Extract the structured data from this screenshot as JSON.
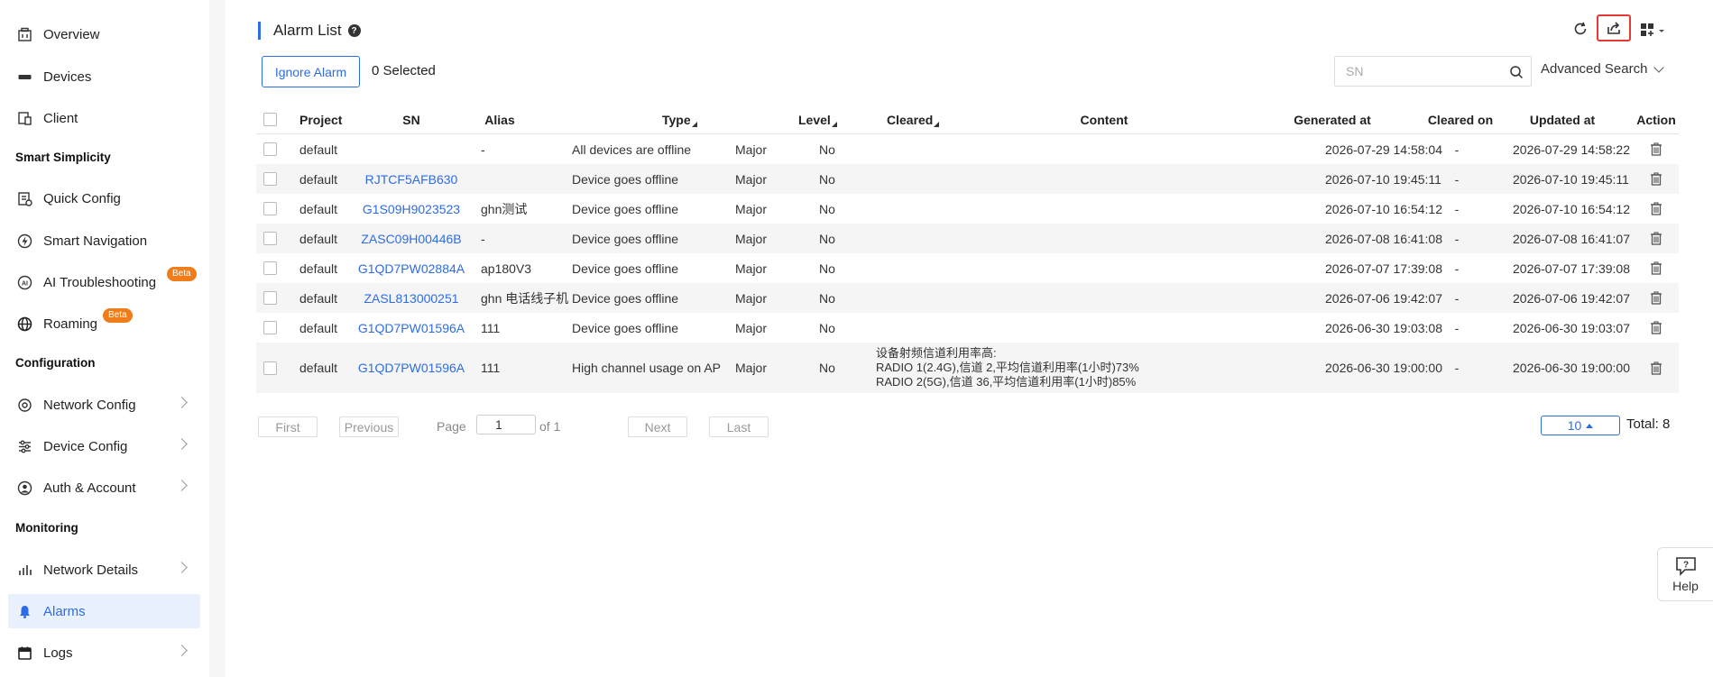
{
  "sidebar": {
    "items": [
      {
        "label": "Overview",
        "icon": "building-icon"
      },
      {
        "label": "Devices",
        "icon": "device-icon"
      },
      {
        "label": "Client",
        "icon": "client-icon"
      },
      {
        "label": "Quick Config",
        "icon": "quick-config-icon"
      },
      {
        "label": "Smart Navigation",
        "icon": "navigation-icon"
      },
      {
        "label": "AI Troubleshooting",
        "icon": "ai-icon",
        "badge": "Beta"
      },
      {
        "label": "Roaming",
        "icon": "globe-icon",
        "badge": "Beta"
      },
      {
        "label": "Network Config",
        "icon": "settings-icon"
      },
      {
        "label": "Device Config",
        "icon": "sliders-icon"
      },
      {
        "label": "Auth & Account",
        "icon": "user-icon"
      },
      {
        "label": "Network Details",
        "icon": "chart-icon"
      },
      {
        "label": "Alarms",
        "icon": "bell-icon"
      },
      {
        "label": "Logs",
        "icon": "calendar-icon"
      }
    ],
    "sections": [
      "Smart Simplicity",
      "Configuration",
      "Monitoring"
    ]
  },
  "header": {
    "title": "Alarm List",
    "help_glyph": "?"
  },
  "toolbar": {
    "ignore_label": "Ignore Alarm",
    "selected_text": "0 Selected",
    "search_placeholder": "SN",
    "advanced_search": "Advanced Search"
  },
  "table": {
    "columns": [
      "Project",
      "SN",
      "Alias",
      "Type",
      "Level",
      "Cleared",
      "Content",
      "Generated at",
      "Cleared on",
      "Updated at",
      "Action"
    ],
    "rows": [
      {
        "project": "default",
        "sn": "",
        "alias": "-",
        "type": "All devices are offline",
        "level": "Major",
        "cleared": "No",
        "content": [],
        "generated": "2026-07-29 14:58:04",
        "cleared_on": "-",
        "updated": "2026-07-29 14:58:22"
      },
      {
        "project": "default",
        "sn": "RJTCF5AFB630",
        "alias": "",
        "type": "Device goes offline",
        "level": "Major",
        "cleared": "No",
        "content": [],
        "generated": "2026-07-10 19:45:11",
        "cleared_on": "-",
        "updated": "2026-07-10 19:45:11"
      },
      {
        "project": "default",
        "sn": "G1S09H9023523",
        "alias": "ghn测试",
        "type": "Device goes offline",
        "level": "Major",
        "cleared": "No",
        "content": [],
        "generated": "2026-07-10 16:54:12",
        "cleared_on": "-",
        "updated": "2026-07-10 16:54:12"
      },
      {
        "project": "default",
        "sn": "ZASC09H00446B",
        "alias": "-",
        "type": "Device goes offline",
        "level": "Major",
        "cleared": "No",
        "content": [],
        "generated": "2026-07-08 16:41:08",
        "cleared_on": "-",
        "updated": "2026-07-08 16:41:07"
      },
      {
        "project": "default",
        "sn": "G1QD7PW02884A",
        "alias": "ap180V3",
        "type": "Device goes offline",
        "level": "Major",
        "cleared": "No",
        "content": [],
        "generated": "2026-07-07 17:39:08",
        "cleared_on": "-",
        "updated": "2026-07-07 17:39:08"
      },
      {
        "project": "default",
        "sn": "ZASL813000251",
        "alias": "ghn 电话线子机",
        "type": "Device goes offline",
        "level": "Major",
        "cleared": "No",
        "content": [],
        "generated": "2026-07-06 19:42:07",
        "cleared_on": "-",
        "updated": "2026-07-06 19:42:07"
      },
      {
        "project": "default",
        "sn": "G1QD7PW01596A",
        "alias": "111",
        "type": "Device goes offline",
        "level": "Major",
        "cleared": "No",
        "content": [],
        "generated": "2026-06-30 19:03:08",
        "cleared_on": "-",
        "updated": "2026-06-30 19:03:07"
      },
      {
        "project": "default",
        "sn": "G1QD7PW01596A",
        "alias": "111",
        "type": "High channel usage on AP",
        "level": "Major",
        "cleared": "No",
        "content": [
          "设备射频信道利用率高:",
          "RADIO 1(2.4G),信道 2,平均信道利用率(1小时)73%",
          "RADIO 2(5G),信道 36,平均信道利用率(1小时)85%"
        ],
        "generated": "2026-06-30 19:00:00",
        "cleared_on": "-",
        "updated": "2026-06-30 19:00:00"
      }
    ]
  },
  "pagination": {
    "first": "First",
    "previous": "Previous",
    "page_label": "Page",
    "page_value": "1",
    "of_label": "of 1",
    "next": "Next",
    "last": "Last",
    "page_size": "10",
    "total": "Total: 8"
  },
  "help": {
    "label": "Help"
  },
  "colors": {
    "accent": "#2e6ce5",
    "highlight": "#e53935",
    "beta": "#f07c1a"
  }
}
